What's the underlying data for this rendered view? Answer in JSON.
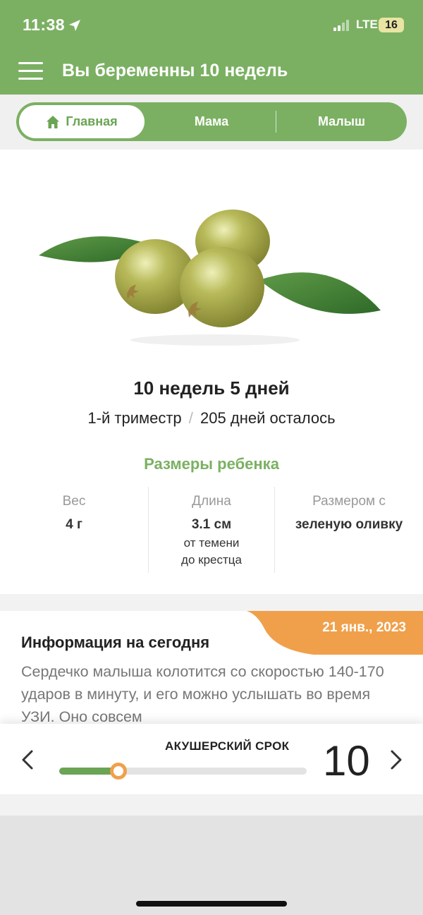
{
  "status": {
    "time": "11:38",
    "network": "LTE",
    "battery": "16"
  },
  "header": {
    "title": "Вы беременны 10 недель"
  },
  "tabs": [
    {
      "label": "Главная",
      "active": true
    },
    {
      "label": "Мама",
      "active": false
    },
    {
      "label": "Малыш",
      "active": false
    }
  ],
  "summary": {
    "weeks_days": "10 недель 5 дней",
    "trimester": "1-й триместр",
    "separator": "/",
    "days_left": "205 дней осталось"
  },
  "baby_size": {
    "title": "Размеры ребенка",
    "weight_label": "Вес",
    "weight_value": "4 г",
    "length_label": "Длина",
    "length_value": "3.1 см",
    "length_note_1": "от темени",
    "length_note_2": "до крестца",
    "compare_label": "Размером с",
    "compare_value": "зеленую оливку"
  },
  "today": {
    "date": "21 янв., 2023",
    "title": "Информация на сегодня",
    "text": "Сердечко малыша колотится со скоростью 140-170 ударов в минуту, и его можно услышать во время УЗИ. Оно совсем"
  },
  "term": {
    "label": "АКУШЕРСКИЙ СРОК",
    "week": "10",
    "progress": 0.24
  },
  "colors": {
    "brand_green": "#7bb062",
    "accent_orange": "#f0a04b"
  }
}
